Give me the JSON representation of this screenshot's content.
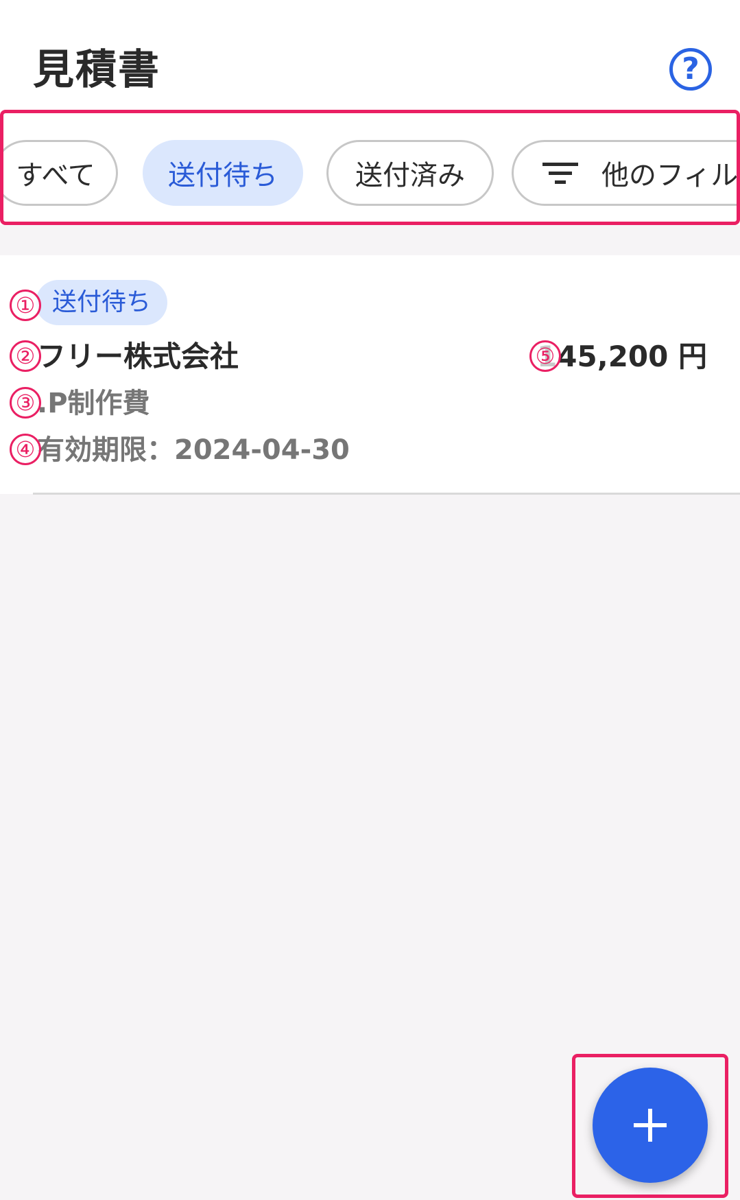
{
  "header": {
    "title": "見積書",
    "help_icon_glyph": "?"
  },
  "filters": {
    "chips": [
      {
        "label": "すべて",
        "selected": false
      },
      {
        "label": "送付待ち",
        "selected": true
      },
      {
        "label": "送付済み",
        "selected": false
      },
      {
        "label": "他のフィルタ",
        "selected": false,
        "icon": "filter-icon"
      }
    ]
  },
  "quotes": [
    {
      "status": "送付待ち",
      "client": "フリー株式会社",
      "subject": ".P制作費",
      "expiry": "有効期限：2024-04-30",
      "amount": "145,200 円"
    }
  ],
  "markers": [
    "①",
    "②",
    "③",
    "④",
    "⑤"
  ],
  "fab": {
    "icon": "plus-icon"
  },
  "colors": {
    "accent": "#2c63e8",
    "chip_selected_bg": "#dbe7fd",
    "chip_selected_text": "#2a5bd7",
    "annotation": "#ea1f63",
    "background": "#f6f4f6"
  }
}
